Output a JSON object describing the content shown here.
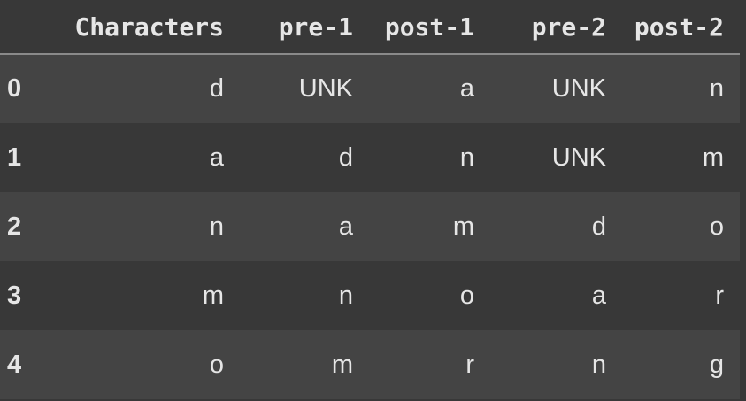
{
  "table": {
    "columns": [
      "Characters",
      "pre-1",
      "post-1",
      "pre-2",
      "post-2"
    ],
    "rows": [
      {
        "index": "0",
        "cells": [
          "d",
          "UNK",
          "a",
          "UNK",
          "n"
        ]
      },
      {
        "index": "1",
        "cells": [
          "a",
          "d",
          "n",
          "UNK",
          "m"
        ]
      },
      {
        "index": "2",
        "cells": [
          "n",
          "a",
          "m",
          "d",
          "o"
        ]
      },
      {
        "index": "3",
        "cells": [
          "m",
          "n",
          "o",
          "a",
          "r"
        ]
      },
      {
        "index": "4",
        "cells": [
          "o",
          "m",
          "r",
          "n",
          "g"
        ]
      }
    ]
  },
  "colors": {
    "background": "#383838",
    "row_stripe": "#444444",
    "text": "#e6e6e6",
    "header_rule": "#8a8a8a"
  }
}
